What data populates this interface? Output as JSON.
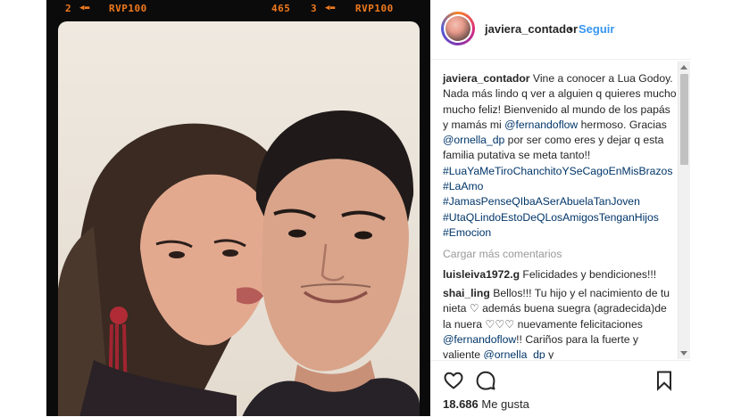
{
  "film_strip": {
    "left_number": "2",
    "left_brand": "RVP100",
    "right_count": "465",
    "right_number": "3",
    "right_brand": "RVP100"
  },
  "header": {
    "username": "javiera_contador",
    "separator": "•",
    "follow_label": "Seguir",
    "avatar_icon": "profile-avatar"
  },
  "caption": {
    "username": "javiera_contador",
    "text_1": " Vine a conocer a Lua Godoy. Nada más lindo q ver a alguien q quieres mucho mucho feliz! Bienvenido al mundo de los papás y mamás mi ",
    "mention_1": "@fernandoflow",
    "text_2": " hermoso. Gracias ",
    "mention_2": "@ornella_dp",
    "text_3": " por ser como eres y dejar q esta familia putativa se meta tanto!! ",
    "hashtag_1": "#LuaYaMeTiroChanchitoYSeCagoEnMisBrazos",
    "hashtag_2": "#LaAmo",
    "hashtag_3": "#JamasPenseQIbaASerAbuelaTanJoven",
    "hashtag_4": "#UtaQLindoEstoDeQLosAmigosTenganHijos",
    "hashtag_5": "#Emocion"
  },
  "load_more_label": "Cargar más comentarios",
  "comments": [
    {
      "username": "luisleiva1972.g",
      "text": " Felicidades y bendiciones!!!"
    },
    {
      "username": "shai_ling",
      "text_1": " Bellos!!! Tu hijo y el nacimiento de tu nieta ♡ además buena suegra (agradecida)de la nuera ♡♡♡ nuevamente felicitaciones ",
      "mention_1": "@fernandoflow",
      "text_2": "!! Cariños para la fuerte y valiente ",
      "mention_2": "@ornella_dp",
      "text_3": " y"
    }
  ],
  "actions": {
    "like_icon": "heart-icon",
    "comment_icon": "comment-icon",
    "save_icon": "bookmark-icon"
  },
  "likes": {
    "count": "18.686",
    "label": " Me gusta"
  },
  "colors": {
    "link": "#3897f0",
    "tag": "#003569",
    "film_text": "#f07a1e",
    "muted": "#999999"
  }
}
